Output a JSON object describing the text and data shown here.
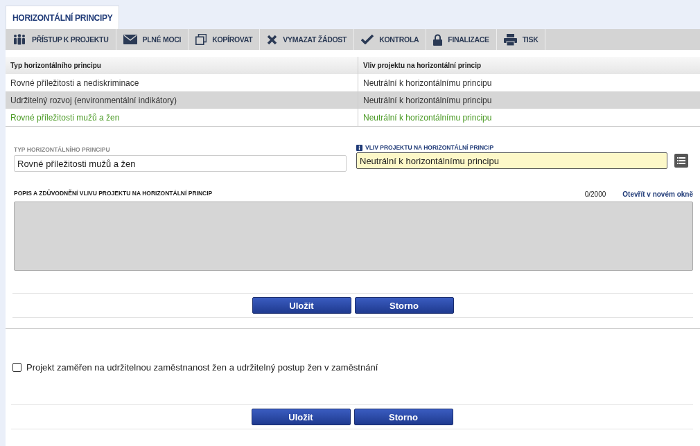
{
  "tabs": [
    {
      "label": "HORIZONTÁLNÍ PRINCIPY",
      "selected": true
    }
  ],
  "toolbar": [
    "PŘÍSTUP K PROJEKTU",
    "PLNÉ MOCI",
    "KOPÍROVAT",
    "VYMAZAT ŽÁDOST",
    "KONTROLA",
    "FINALIZACE",
    "TISK"
  ],
  "table": {
    "columns": [
      "Typ horizontálního principu",
      "Vliv projektu na horizontální princip"
    ],
    "rows": [
      {
        "cells": [
          "Rovné příležitosti a nediskriminace",
          "Neutrální k horizontálnímu principu"
        ],
        "selected": false
      },
      {
        "cells": [
          "Udržitelný rozvoj (environmentální indikátory)",
          "Neutrální k horizontálnímu principu"
        ],
        "selected": false
      },
      {
        "cells": [
          "Rovné příležitosti mužů a žen",
          "Neutrální k horizontálnímu principu"
        ],
        "selected": true
      }
    ]
  },
  "form": {
    "type_label": "TYP HORIZONTÁLNÍHO PRINCIPU",
    "type_value": "Rovné příležitosti mužů a žen",
    "impact_label": "VLIV PROJEKTU NA HORIZONTÁLNÍ PRINCIP",
    "impact_value": "Neutrální k horizontálnímu principu",
    "description_label": "POPIS A ZDŮVODNĚNÍ VLIVU PROJEKTU NA HORIZONTÁLNÍ PRINCIP",
    "counter": "0/2000",
    "open_link": "Otevřít v novém okně",
    "buttons": [
      "Uložit",
      "Storno"
    ]
  },
  "checkbox_section": {
    "label": "Projekt zaměřen na udržitelnou zaměstnanost žen a udržitelný postup žen v zaměstnání",
    "checked": false,
    "buttons": [
      "Uložit",
      "Storno"
    ]
  }
}
